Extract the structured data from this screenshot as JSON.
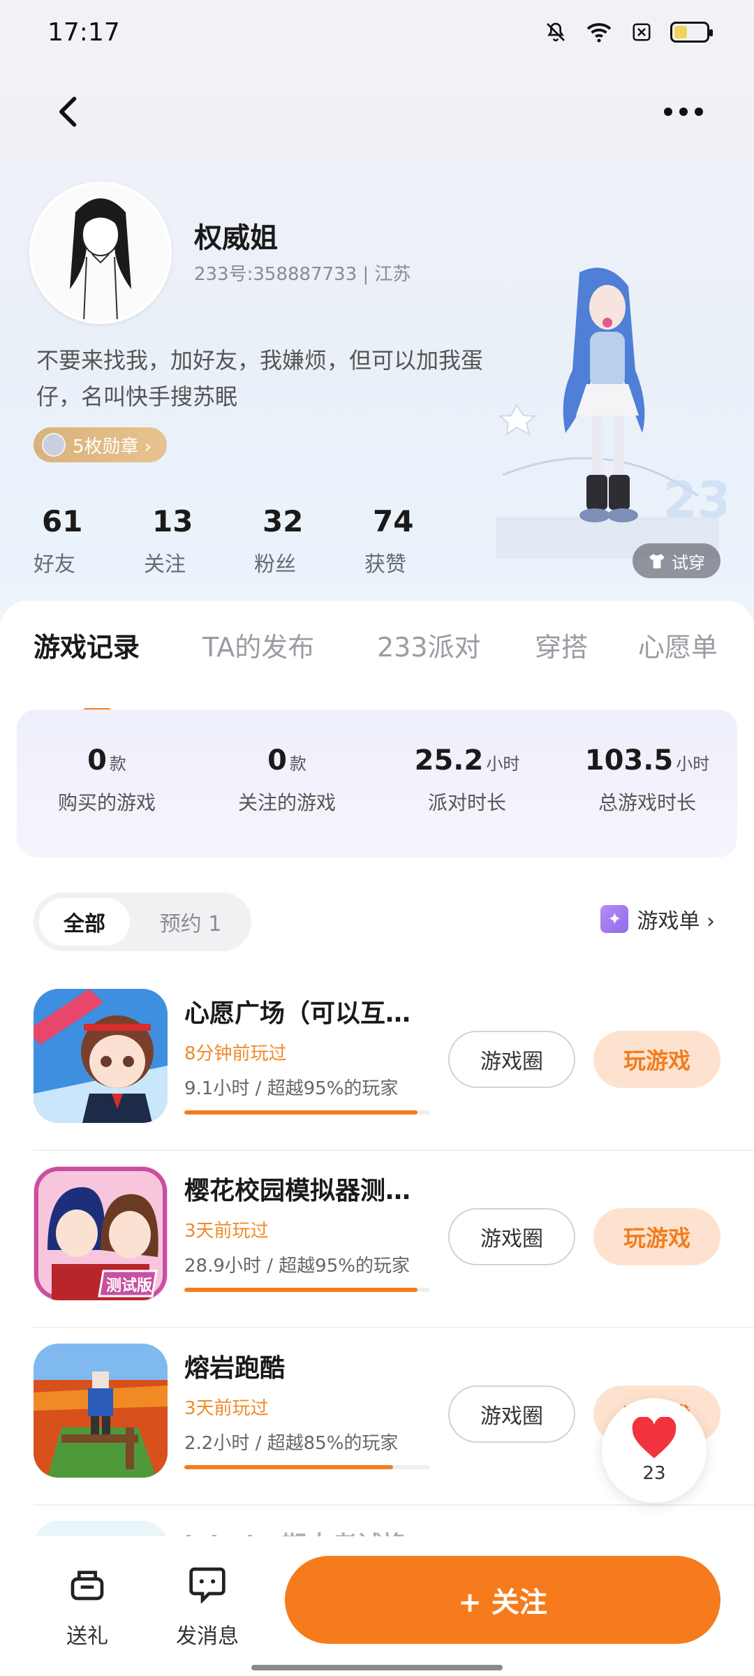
{
  "status_bar": {
    "time": "17:17",
    "battery_level": 0.4
  },
  "profile": {
    "nickname": "权威姐",
    "user_id_line": "233号:358887733 | 江苏",
    "bio": "不要来找我，加好友，我嫌烦，但可以加我蛋仔，名叫快手搜苏眠",
    "medal_label": "5枚勋章 ›",
    "stats": [
      {
        "value": "61",
        "label": "好友"
      },
      {
        "value": "13",
        "label": "关注"
      },
      {
        "value": "32",
        "label": "粉丝"
      },
      {
        "value": "74",
        "label": "获赞"
      }
    ],
    "try_on_label": "试穿"
  },
  "tabs": [
    "游戏记录",
    "TA的发布",
    "233派对",
    "穿搭",
    "心愿单"
  ],
  "summary": [
    {
      "value": "0",
      "unit": "款",
      "label": "购买的游戏"
    },
    {
      "value": "0",
      "unit": "款",
      "label": "关注的游戏"
    },
    {
      "value": "25.2",
      "unit": "小时",
      "label": "派对时长"
    },
    {
      "value": "103.5",
      "unit": "小时",
      "label": "总游戏时长"
    }
  ],
  "filters": {
    "all": "全部",
    "reserve": "预约 1"
  },
  "game_list_link": "游戏单 ›",
  "games": [
    {
      "title": "心愿广场（可以互…",
      "played": "8分钟前玩过",
      "stat": "9.1小时 / 超越95%的玩家",
      "progress": 0.95,
      "circle_label": "游戏圈",
      "play_label": "玩游戏"
    },
    {
      "title": "樱花校园模拟器测…",
      "played": "3天前玩过",
      "stat": "28.9小时 / 超越95%的玩家",
      "progress": 0.95,
      "circle_label": "游戏圈",
      "play_label": "玩游戏"
    },
    {
      "title": "熔岩跑酷",
      "played": "3天前玩过",
      "stat": "2.2小时 / 超越85%的玩家",
      "progress": 0.85,
      "circle_label": "游戏圈",
      "play_label": "玩游戏"
    },
    {
      "title": "labubu期末考试换…"
    }
  ],
  "favorite_count": "23",
  "bottom_bar": {
    "gift_label": "送礼",
    "message_label": "发消息",
    "follow_label": "+ 关注"
  },
  "colors": {
    "accent": "#f67b1c",
    "accent_light": "#fde3cf"
  }
}
